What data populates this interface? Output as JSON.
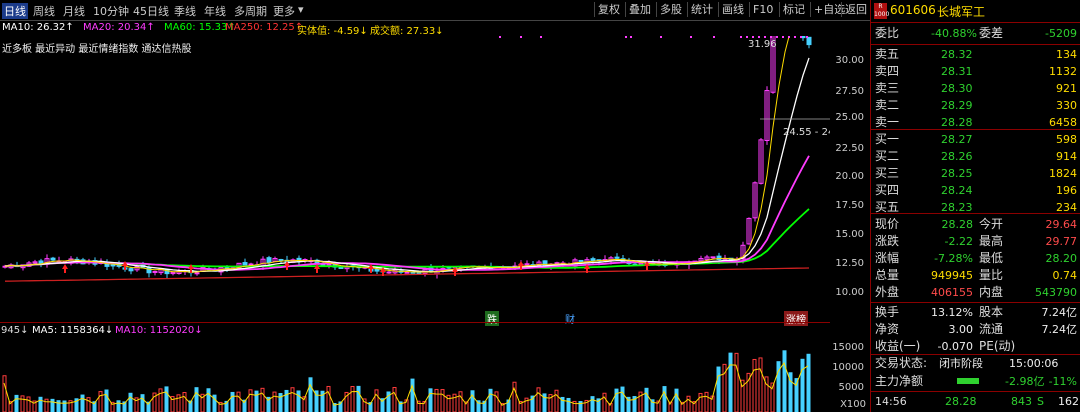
{
  "toolbar": {
    "periods": [
      "日线",
      "周线",
      "月线",
      "10分钟",
      "45日线",
      "季线",
      "年线",
      "多周期",
      "更多"
    ],
    "active_period": 0,
    "buttons": [
      "复权",
      "叠加",
      "多股",
      "统计",
      "画线",
      "F10",
      "标记",
      "+自选",
      "返回"
    ]
  },
  "ma_line": {
    "ma10": {
      "label": "MA10: 26.32↑",
      "color": "#ffffff"
    },
    "ma20": {
      "label": "MA20: 20.34↑",
      "color": "#ff3cff"
    },
    "ma60": {
      "label": "MA60: 15.33↑",
      "color": "#00ff00"
    },
    "ma250": {
      "label": "MA250: 12.25↑",
      "color": "#ff3333"
    },
    "shiti": {
      "label": "实体值: -4.59↓",
      "color": "#ffdd00"
    },
    "chengjiao": {
      "label": "成交额: 27.33↓",
      "color": "#ffdd00"
    }
  },
  "tags_line": "近多板 最近异动 最近情绪指数 通达信热股",
  "price_axis": [
    "30.00",
    "27.50",
    "25.00",
    "22.50",
    "20.00",
    "17.50",
    "15.00",
    "12.50",
    "10.00"
  ],
  "annotations": {
    "high_label": "31.96",
    "cursor_label": "24.55 - 24",
    "marker_die": "跌",
    "marker_cai": "财",
    "marker_zhangting": "涨榜"
  },
  "volume": {
    "vol_label": "945↓",
    "ma5_label": "MA5: 1158364↓",
    "ma10_label": "MA10: 1152020↓",
    "axis": [
      "15000",
      "10000",
      "5000"
    ],
    "axis_unit": "X100"
  },
  "stock": {
    "badge_top": "R",
    "badge_bottom": "1000",
    "code": "601606",
    "name": "长城军工"
  },
  "order_ratio": {
    "label1": "委比",
    "value1": "-40.88%",
    "label2": "委差",
    "value2": "-5209"
  },
  "asks": [
    {
      "label": "卖五",
      "price": "28.32",
      "qty": "134"
    },
    {
      "label": "卖四",
      "price": "28.31",
      "qty": "1132"
    },
    {
      "label": "卖三",
      "price": "28.30",
      "qty": "921"
    },
    {
      "label": "卖二",
      "price": "28.29",
      "qty": "330"
    },
    {
      "label": "卖一",
      "price": "28.28",
      "qty": "6458"
    }
  ],
  "bids": [
    {
      "label": "买一",
      "price": "28.27",
      "qty": "598"
    },
    {
      "label": "买二",
      "price": "28.26",
      "qty": "914"
    },
    {
      "label": "买三",
      "price": "28.25",
      "qty": "1824"
    },
    {
      "label": "买四",
      "price": "28.24",
      "qty": "196"
    },
    {
      "label": "买五",
      "price": "28.23",
      "qty": "234"
    }
  ],
  "quote": [
    {
      "l1": "现价",
      "v1": "28.28",
      "c1": "green",
      "l2": "今开",
      "v2": "29.64",
      "c2": "red"
    },
    {
      "l1": "涨跌",
      "v1": "-2.22",
      "c1": "green",
      "l2": "最高",
      "v2": "29.77",
      "c2": "red"
    },
    {
      "l1": "涨幅",
      "v1": "-7.28%",
      "c1": "green",
      "l2": "最低",
      "v2": "28.20",
      "c2": "green"
    },
    {
      "l1": "总量",
      "v1": "949945",
      "c1": "yellow",
      "l2": "量比",
      "v2": "0.74",
      "c2": "yellow"
    },
    {
      "l1": "外盘",
      "v1": "406155",
      "c1": "red",
      "l2": "内盘",
      "v2": "543790",
      "c2": "green"
    }
  ],
  "fundamentals": [
    {
      "l1": "换手",
      "v1": "13.12%",
      "l2": "股本",
      "v2": "7.24亿"
    },
    {
      "l1": "净资",
      "v1": "3.00",
      "l2": "流通",
      "v2": "7.24亿"
    },
    {
      "l1": "收益(一)",
      "v1": "-0.070",
      "l2": "PE(动)",
      "v2": ""
    }
  ],
  "trade_status": {
    "label": "交易状态:",
    "status": "闭市阶段",
    "time": "15:00:06"
  },
  "main_flow": {
    "label": "主力净额",
    "value": "-2.98亿",
    "pct": "-11%"
  },
  "last_tick": {
    "time": "14:56",
    "price": "28.28",
    "qty": "843",
    "side": "S",
    "extra": "162"
  }
}
